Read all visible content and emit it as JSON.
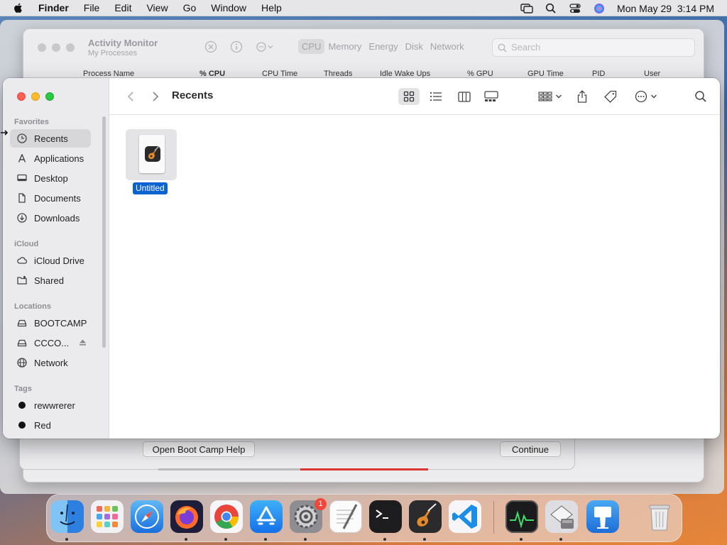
{
  "menubar": {
    "app": "Finder",
    "items": [
      "File",
      "Edit",
      "View",
      "Go",
      "Window",
      "Help"
    ],
    "clock": "Mon May 29  3:14 PM"
  },
  "activity_monitor": {
    "title": "Activity Monitor",
    "subtitle": "My Processes",
    "tabs": [
      "CPU",
      "Memory",
      "Energy",
      "Disk",
      "Network"
    ],
    "active_tab": "CPU",
    "search_placeholder": "Search",
    "columns": [
      "Process Name",
      "% CPU",
      "CPU Time",
      "Threads",
      "Idle Wake Ups",
      "% GPU",
      "GPU Time",
      "PID",
      "User"
    ]
  },
  "bootcamp": {
    "help_button": "Open Boot Camp Help",
    "continue_button": "Continue"
  },
  "finder": {
    "title": "Recents",
    "sidebar": {
      "favorites_label": "Favorites",
      "favorites": [
        "Recents",
        "Applications",
        "Desktop",
        "Documents",
        "Downloads"
      ],
      "icloud_label": "iCloud",
      "icloud": [
        "iCloud Drive",
        "Shared"
      ],
      "locations_label": "Locations",
      "locations": [
        "BOOTCAMP",
        "CCCO...",
        "Network"
      ],
      "tags_label": "Tags",
      "tags": [
        "rewwrerer",
        "Red"
      ]
    },
    "files": [
      {
        "name": "Untitled",
        "icon": "garageband-document-icon",
        "selected": true
      }
    ]
  },
  "dock": {
    "apps": [
      "Finder",
      "Launchpad",
      "Safari",
      "Firefox",
      "Chrome",
      "App Store",
      "System Settings",
      "TextEdit",
      "Terminal",
      "GarageBand",
      "Visual Studio Code",
      "Activity Monitor",
      "Boot Camp Assistant",
      "Keynote",
      "Trash"
    ],
    "settings_badge": "1"
  },
  "colors": {
    "selection": "#0b63d1",
    "close": "#fe5f57",
    "minimize": "#febc2e",
    "maximize": "#28c840"
  }
}
